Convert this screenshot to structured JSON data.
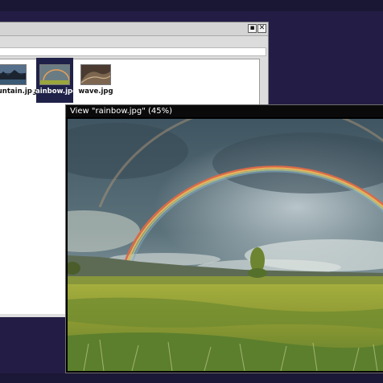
{
  "browser": {
    "files": [
      {
        "name": "mountain.jpg",
        "selected": false
      },
      {
        "name": "rainbow.jpg",
        "selected": true
      },
      {
        "name": "wave.jpg",
        "selected": false
      }
    ],
    "min_symbol": "▪",
    "close_symbol": "✕"
  },
  "viewer": {
    "title": "View \"rainbow.jpg\" (45%)",
    "image": "rainbow-landscape-photo"
  },
  "colors": {
    "desktop": "#231d45",
    "selection": "#1f2148",
    "rainbow_sky": "#4e6470",
    "grass": "#98a73a"
  }
}
